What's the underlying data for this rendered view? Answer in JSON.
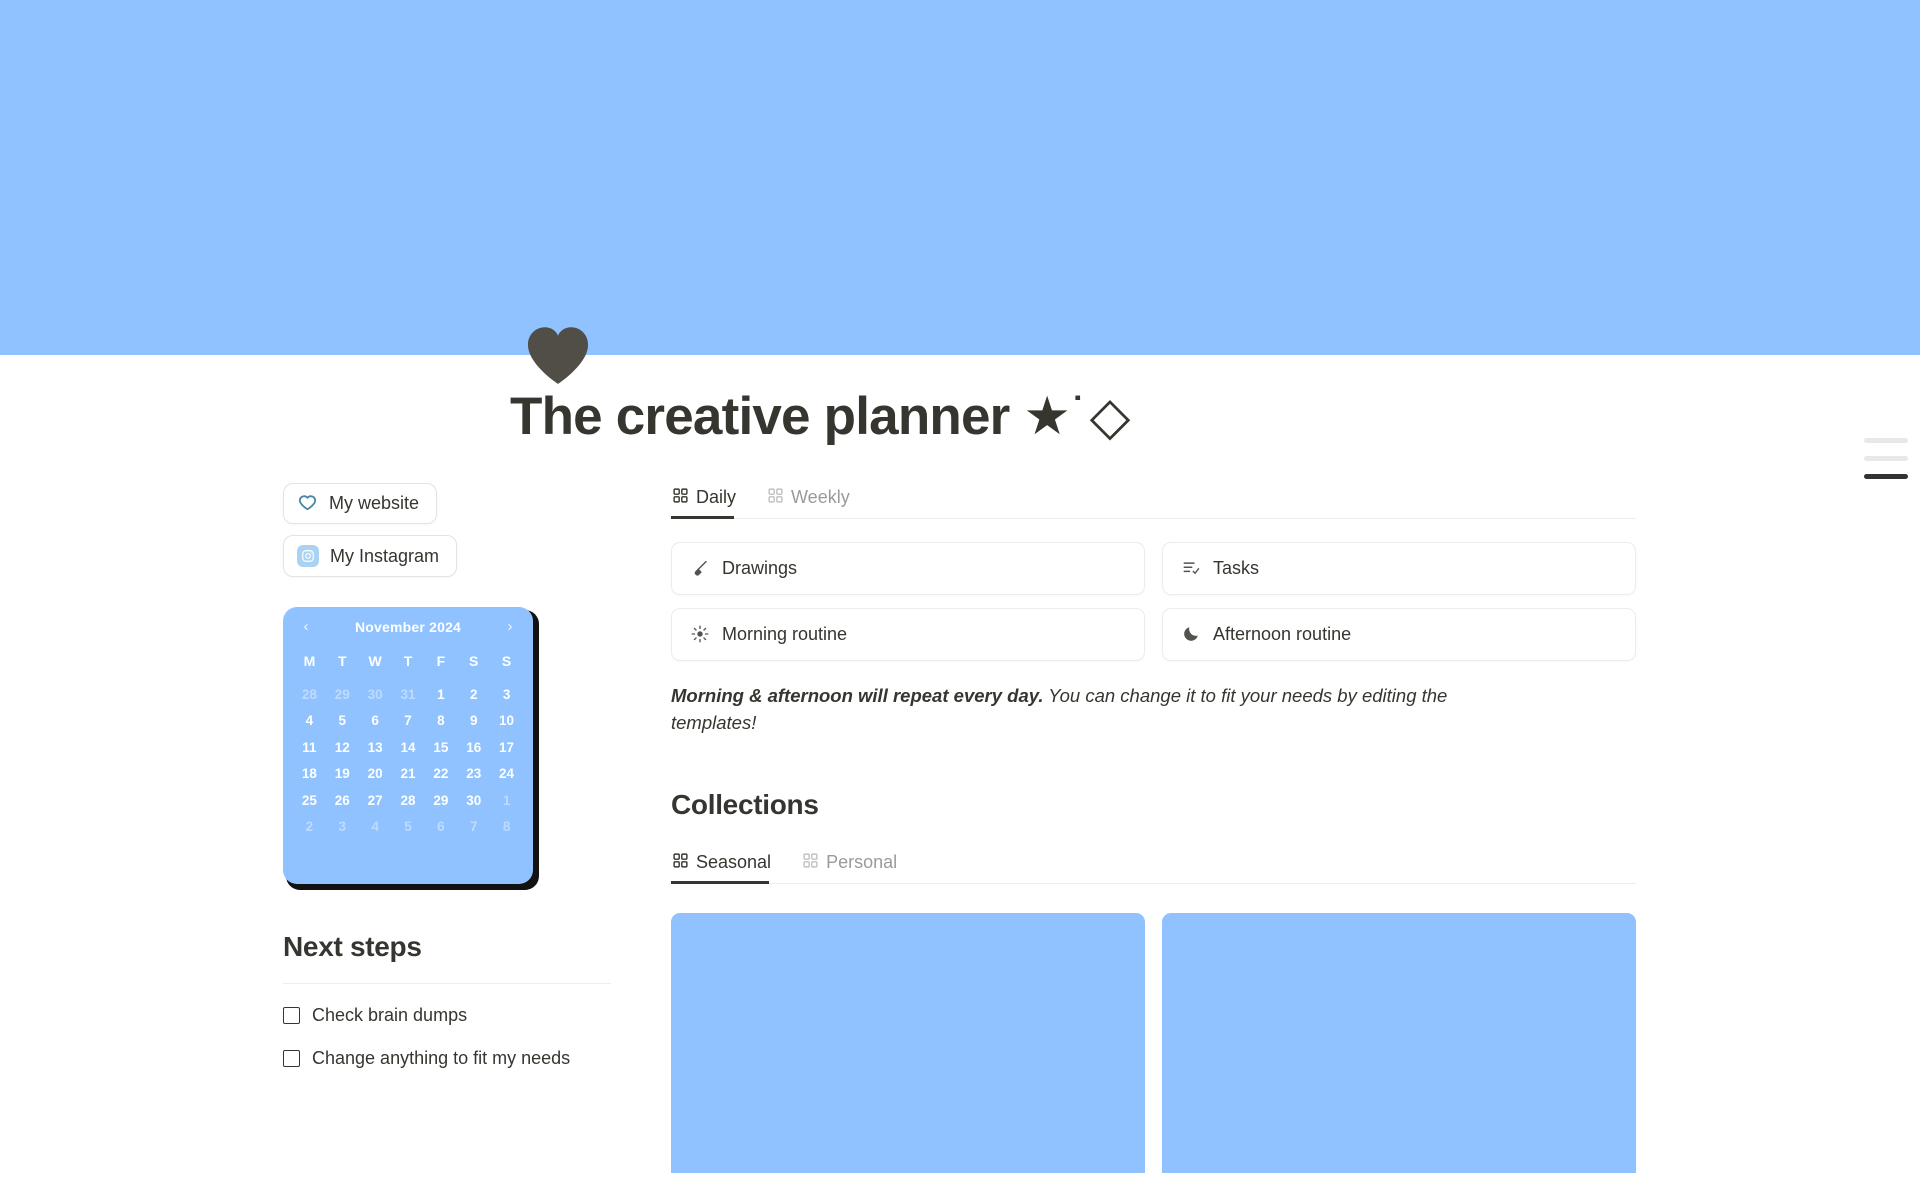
{
  "cover": {
    "color": "#8fc2ff"
  },
  "page_icon": {
    "name": "heart-icon",
    "color": "#514e47"
  },
  "header": {
    "title": "The creative planner",
    "title_decoration": "★˙◇"
  },
  "toc": {
    "lines": 3,
    "active_index": 2
  },
  "sidebar": {
    "links": [
      {
        "label": "My website",
        "icon": "heart-outline-icon"
      },
      {
        "label": "My Instagram",
        "icon": "instagram-icon"
      }
    ],
    "calendar": {
      "month_label": "November 2024",
      "prev_label": "‹",
      "next_label": "›",
      "weekdays": [
        "M",
        "T",
        "W",
        "T",
        "F",
        "S",
        "S"
      ],
      "weeks": [
        [
          {
            "d": "28",
            "out": true
          },
          {
            "d": "29",
            "out": true
          },
          {
            "d": "30",
            "out": true
          },
          {
            "d": "31",
            "out": true
          },
          {
            "d": "1",
            "out": false
          },
          {
            "d": "2",
            "out": false
          },
          {
            "d": "3",
            "out": false
          }
        ],
        [
          {
            "d": "4",
            "out": false
          },
          {
            "d": "5",
            "out": false
          },
          {
            "d": "6",
            "out": false
          },
          {
            "d": "7",
            "out": false
          },
          {
            "d": "8",
            "out": false
          },
          {
            "d": "9",
            "out": false
          },
          {
            "d": "10",
            "out": false
          }
        ],
        [
          {
            "d": "11",
            "out": false
          },
          {
            "d": "12",
            "out": false
          },
          {
            "d": "13",
            "out": false
          },
          {
            "d": "14",
            "out": false
          },
          {
            "d": "15",
            "out": false
          },
          {
            "d": "16",
            "out": false
          },
          {
            "d": "17",
            "out": false
          }
        ],
        [
          {
            "d": "18",
            "out": false
          },
          {
            "d": "19",
            "out": false
          },
          {
            "d": "20",
            "out": false
          },
          {
            "d": "21",
            "out": false
          },
          {
            "d": "22",
            "out": false
          },
          {
            "d": "23",
            "out": false
          },
          {
            "d": "24",
            "out": false
          }
        ],
        [
          {
            "d": "25",
            "out": false
          },
          {
            "d": "26",
            "out": false
          },
          {
            "d": "27",
            "out": false
          },
          {
            "d": "28",
            "out": false
          },
          {
            "d": "29",
            "out": false
          },
          {
            "d": "30",
            "out": false
          },
          {
            "d": "1",
            "out": true
          }
        ],
        [
          {
            "d": "2",
            "out": true
          },
          {
            "d": "3",
            "out": true
          },
          {
            "d": "4",
            "out": true
          },
          {
            "d": "5",
            "out": true
          },
          {
            "d": "6",
            "out": true
          },
          {
            "d": "7",
            "out": true
          },
          {
            "d": "8",
            "out": true
          }
        ]
      ]
    },
    "next_steps": {
      "heading": "Next steps",
      "todos": [
        {
          "label": "Check brain dumps",
          "checked": false
        },
        {
          "label": "Change anything to fit my needs",
          "checked": false
        }
      ]
    }
  },
  "main": {
    "planner_tabs": [
      {
        "label": "Daily",
        "icon": "grid-icon",
        "active": true
      },
      {
        "label": "Weekly",
        "icon": "grid-icon",
        "active": false
      }
    ],
    "planner_cards": [
      {
        "label": "Drawings",
        "icon": "paintbrush-icon"
      },
      {
        "label": "Tasks",
        "icon": "task-list-icon"
      },
      {
        "label": "Morning routine",
        "icon": "sun-icon"
      },
      {
        "label": "Afternoon routine",
        "icon": "moon-icon"
      }
    ],
    "note": {
      "bold": "Morning & afternoon will repeat every day.",
      "rest": " You can change it to fit your needs by editing the templates!"
    },
    "collections": {
      "heading": "Collections",
      "tabs": [
        {
          "label": "Seasonal",
          "icon": "grid-icon",
          "active": true
        },
        {
          "label": "Personal",
          "icon": "grid-icon",
          "active": false
        }
      ],
      "gallery": [
        {
          "name": "collection-card-1",
          "color": "#8fc2ff"
        },
        {
          "name": "collection-card-2",
          "color": "#8fc2ff"
        }
      ]
    }
  }
}
